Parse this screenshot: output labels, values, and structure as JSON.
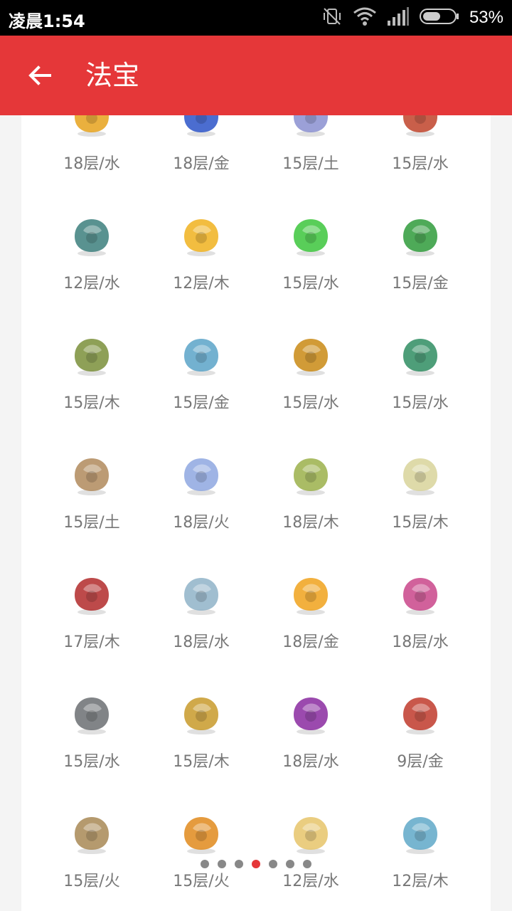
{
  "status_bar": {
    "time": "凌晨1:54",
    "battery": "53%"
  },
  "header": {
    "title": "法宝"
  },
  "items": [
    {
      "label": "18层/水",
      "icon": "golden-dragon-treasure-icon",
      "color": "#e6a21c"
    },
    {
      "label": "18层/金",
      "icon": "blue-orb-icon",
      "color": "#2b54c8"
    },
    {
      "label": "15层/土",
      "icon": "feather-icon",
      "color": "#8a8fd0"
    },
    {
      "label": "15层/水",
      "icon": "bell-icon",
      "color": "#c0432a"
    },
    {
      "label": "12层/水",
      "icon": "bronze-cauldron-icon",
      "color": "#3c7f7c"
    },
    {
      "label": "12层/木",
      "icon": "golden-rope-icon",
      "color": "#f0b21f"
    },
    {
      "label": "15层/水",
      "icon": "jade-ruler-icon",
      "color": "#3cc53c"
    },
    {
      "label": "15层/金",
      "icon": "jade-ruyi-icon",
      "color": "#2f9b3b"
    },
    {
      "label": "15层/木",
      "icon": "gourd-pouch-icon",
      "color": "#7a8f3a"
    },
    {
      "label": "15层/金",
      "icon": "cloud-disc-icon",
      "color": "#5aa3c8"
    },
    {
      "label": "15层/水",
      "icon": "golden-cauldron-icon",
      "color": "#c98a14"
    },
    {
      "label": "15层/水",
      "icon": "green-umbrella-icon",
      "color": "#2f8d62"
    },
    {
      "label": "15层/土",
      "icon": "clay-figure-icon",
      "color": "#b08a5c"
    },
    {
      "label": "18层/火",
      "icon": "white-crane-icon",
      "color": "#8ea7e0"
    },
    {
      "label": "18层/木",
      "icon": "jade-seal-icon",
      "color": "#9bb04a"
    },
    {
      "label": "15层/木",
      "icon": "paper-doll-icon",
      "color": "#d8d49a"
    },
    {
      "label": "17层/木",
      "icon": "red-flame-banner-icon",
      "color": "#b22a2a"
    },
    {
      "label": "18层/水",
      "icon": "jade-flute-icon",
      "color": "#8fb3c8"
    },
    {
      "label": "18层/金",
      "icon": "golden-talisman-icon",
      "color": "#f0a21c"
    },
    {
      "label": "18层/水",
      "icon": "phoenix-ornament-icon",
      "color": "#c9458a"
    },
    {
      "label": "15层/水",
      "icon": "stone-lantern-icon",
      "color": "#6b6f72"
    },
    {
      "label": "15层/木",
      "icon": "palm-fan-icon",
      "color": "#c89a2a"
    },
    {
      "label": "18层/水",
      "icon": "skull-banner-icon",
      "color": "#8a2aa0"
    },
    {
      "label": "9层/金",
      "icon": "scorpion-charm-icon",
      "color": "#c0392b"
    },
    {
      "label": "15层/火",
      "icon": "hand-mirror-icon",
      "color": "#a88855"
    },
    {
      "label": "15层/火",
      "icon": "golden-pagoda-icon",
      "color": "#e08a1c"
    },
    {
      "label": "12层/水",
      "icon": "scroll-icon",
      "color": "#e6c46a"
    },
    {
      "label": "12层/木",
      "icon": "blue-beast-icon",
      "color": "#5fa8c8"
    }
  ],
  "pagination": {
    "total": 7,
    "active": 3
  }
}
